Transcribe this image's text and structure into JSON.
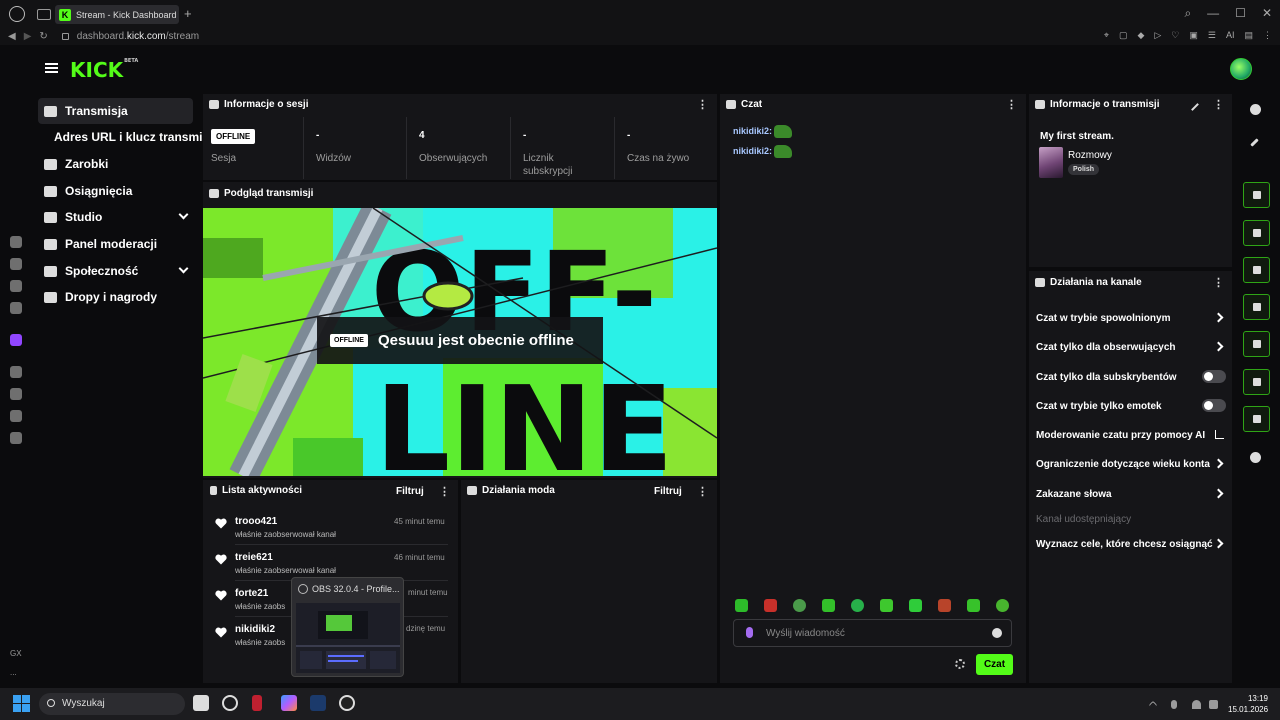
{
  "browser": {
    "tab_title": "Stream - Kick Dashboard",
    "tab_favicon": "K",
    "url_prefix": "dashboard.",
    "url_domain": "kick.com",
    "url_path": "/stream",
    "new_tab_label": "+",
    "ai_label": "AI"
  },
  "brand": {
    "logo": "KICK",
    "logo_tag": "BETA",
    "accent": "#53fc18"
  },
  "rail": {
    "gx_label": "GX",
    "more_label": "..."
  },
  "sidebar": {
    "items": [
      {
        "label": "Transmisja",
        "icon": "broadcast-icon"
      },
      {
        "label": "Zarobki",
        "icon": "bar-chart-icon"
      },
      {
        "label": "Osiągnięcia",
        "icon": "trophy-icon"
      },
      {
        "label": "Studio",
        "icon": "studio-icon"
      },
      {
        "label": "Panel moderacji",
        "icon": "hammer-icon"
      },
      {
        "label": "Społeczność",
        "icon": "users-icon"
      },
      {
        "label": "Dropy i nagrody",
        "icon": "gift-icon"
      }
    ],
    "subitem": "Adres URL i klucz transmisji"
  },
  "session": {
    "title": "Informacje o sesji",
    "badge": "OFFLINE",
    "stats": [
      {
        "value": "",
        "label": "Sesja"
      },
      {
        "value": "-",
        "label": "Widzów"
      },
      {
        "value": "4",
        "label": "Obserwujących"
      },
      {
        "value": "-",
        "label": "Licznik subskrypcji"
      },
      {
        "value": "-",
        "label": "Czas na żywo"
      }
    ]
  },
  "preview": {
    "title": "Podgląd transmisji",
    "badge": "OFFLINE",
    "message": "Qesuuu jest obecnie offline",
    "art_top": "OFF-",
    "art_bottom": "LINE"
  },
  "activity": {
    "title": "Lista aktywności",
    "filter": "Filtruj",
    "items": [
      {
        "name": "trooo421",
        "action": "właśnie zaobserwował kanał",
        "time": "45 minut temu"
      },
      {
        "name": "treie621",
        "action": "właśnie zaobserwował kanał",
        "time": "46 minut temu"
      },
      {
        "name": "forte21",
        "action": "właśnie zaobs",
        "time": "minut temu"
      },
      {
        "name": "nikidiki2",
        "action": "właśnie zaobs",
        "time": "dzinę temu"
      }
    ]
  },
  "mod_actions": {
    "title": "Działania moda",
    "filter": "Filtruj"
  },
  "chat": {
    "title": "Czat",
    "messages": [
      {
        "user": "nikidiki2:"
      },
      {
        "user": "nikidiki2:"
      }
    ],
    "input_placeholder": "Wyślij wiadomość",
    "send_label": "Czat",
    "emote_colors": [
      "#2dbb2a",
      "#c8302a",
      "#4a9a4a",
      "#33c02a",
      "#27b04a",
      "#3ec82e",
      "#2fcc3a",
      "#b8442a",
      "#37c22a",
      "#48b52e"
    ]
  },
  "stream_info": {
    "title": "Informacje o transmisji",
    "stream_title": "My first stream.",
    "category": "Rozmowy",
    "language": "Polish"
  },
  "channel_actions": {
    "title": "Działania na kanale",
    "items": [
      {
        "label": "Czat w trybie spowolnionym",
        "control": "arrow"
      },
      {
        "label": "Czat tylko dla obserwujących",
        "control": "arrow"
      },
      {
        "label": "Czat tylko dla subskrybentów",
        "control": "toggle"
      },
      {
        "label": "Czat w trybie tylko emotek",
        "control": "toggle"
      },
      {
        "label": "Moderowanie czatu przy pomocy AI",
        "control": "chart"
      },
      {
        "label": "Ograniczenie dotyczące wieku konta",
        "control": "arrow"
      },
      {
        "label": "Zakazane słowa",
        "control": "arrow"
      },
      {
        "label": "Kanał udostępniający",
        "control": "none"
      },
      {
        "label": "Wyznacz cele, które chcesz osiągnąć",
        "control": "arrow"
      }
    ]
  },
  "obs_popup": {
    "title": "OBS 32.0.4 - Profile..."
  },
  "taskbar": {
    "search_placeholder": "Wyszukaj",
    "time": "13:19",
    "date": "15.01.2026"
  }
}
